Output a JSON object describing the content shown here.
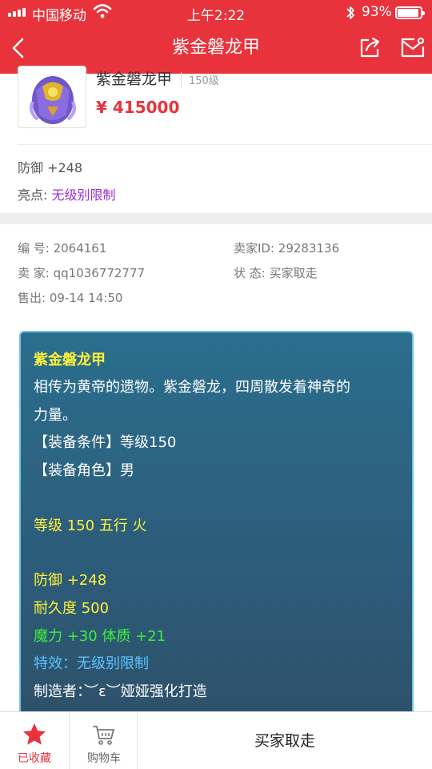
{
  "status_bar": {
    "carrier": "中国移动",
    "time": "上午2:22",
    "battery_percent": "93%",
    "battery_level": 0.93
  },
  "nav": {
    "title": "紫金磐龙甲"
  },
  "product": {
    "name": "紫金磐龙甲",
    "level": "150级",
    "price": "¥ 415000",
    "attr": "防御 +248",
    "highlight_label": "亮点: ",
    "highlight_value": "无级别限制"
  },
  "info": {
    "serial": "编  号: 2064161",
    "seller_id": "卖家ID: 29283136",
    "seller": "卖  家: qq1036772777",
    "state": "状  态: 买家取走",
    "sold": "售出: 09-14 14:50"
  },
  "card": {
    "lines": [
      "紫金磐龙甲",
      "相传为黄帝的遗物。紫金磐龙，四周散发着神奇的",
      "力量。",
      "【装备条件】等级150",
      "【装备角色】男",
      "等级 150 五行 火",
      "防御 +248",
      "耐久度 500",
      "魔力 +30 体质 +21",
      "特效：无级别限制",
      "制造者：︶ε︶娅娅强化打造"
    ],
    "colors": {
      "title": "#fff23a",
      "white": "#ffffff",
      "green": "#3cf03c",
      "blue": "#5cc3ff"
    }
  },
  "bottom": {
    "fav_label": "已收藏",
    "cart_label": "购物车",
    "status": "买家取走"
  },
  "colors": {
    "brand_red": "#e8333c",
    "highlight_purple": "#9b30d9"
  }
}
